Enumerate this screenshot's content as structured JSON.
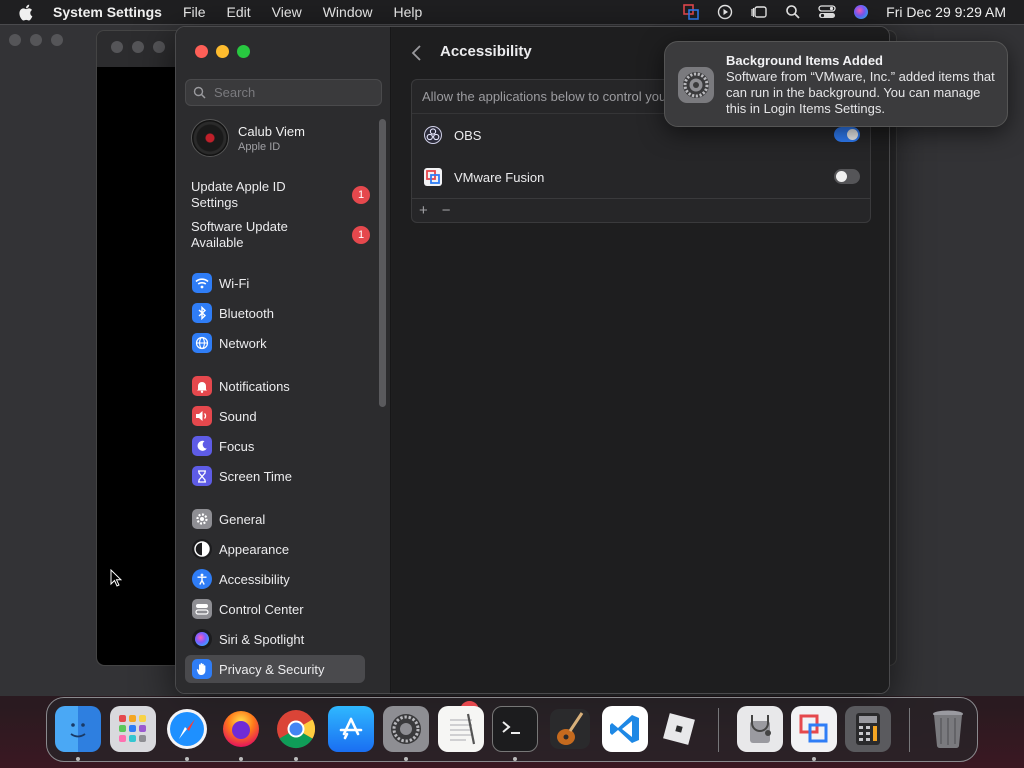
{
  "menubar": {
    "app_name": "System Settings",
    "menus": [
      "File",
      "Edit",
      "View",
      "Window",
      "Help"
    ],
    "clock": "Fri Dec 29  9:29 AM"
  },
  "sidebar": {
    "search_placeholder": "Search",
    "profile": {
      "name": "Calub Viem",
      "subtitle": "Apple ID"
    },
    "alerts": [
      {
        "label": "Update Apple ID Settings",
        "count": "1"
      },
      {
        "label": "Software Update Available",
        "count": "1"
      }
    ],
    "items": [
      {
        "label": "Wi-Fi",
        "icon": "wifi-icon",
        "color": "#2f7df6"
      },
      {
        "label": "Bluetooth",
        "icon": "bluetooth-icon",
        "color": "#2f7df6"
      },
      {
        "label": "Network",
        "icon": "globe-icon",
        "color": "#2f7df6"
      },
      {
        "label": "Notifications",
        "icon": "bell-icon",
        "color": "#e5484d"
      },
      {
        "label": "Sound",
        "icon": "speaker-icon",
        "color": "#e5484d"
      },
      {
        "label": "Focus",
        "icon": "moon-icon",
        "color": "#5e5ce6"
      },
      {
        "label": "Screen Time",
        "icon": "hourglass-icon",
        "color": "#5e5ce6"
      },
      {
        "label": "General",
        "icon": "gear-icon",
        "color": "#8e8e93"
      },
      {
        "label": "Appearance",
        "icon": "appearance-icon",
        "color": "#1c1c1e"
      },
      {
        "label": "Accessibility",
        "icon": "accessibility-icon",
        "color": "#2f7df6"
      },
      {
        "label": "Control Center",
        "icon": "control-center-icon",
        "color": "#8e8e93"
      },
      {
        "label": "Siri & Spotlight",
        "icon": "siri-icon",
        "color": "#1c1c1e"
      },
      {
        "label": "Privacy & Security",
        "icon": "hand-icon",
        "color": "#2f7df6"
      }
    ]
  },
  "content": {
    "title": "Accessibility",
    "panel_header": "Allow the applications below to control your computer.",
    "apps": [
      {
        "name": "OBS",
        "enabled": true
      },
      {
        "name": "VMware Fusion",
        "enabled": false
      }
    ],
    "add_label": "+",
    "remove_label": "−"
  },
  "notification": {
    "title": "Background Items Added",
    "body": "Software from “VMware, Inc.” added items that can run in the background. You can manage this in Login Items Settings."
  },
  "dock": {
    "items": [
      "finder-icon",
      "launchpad-icon",
      "safari-icon",
      "firefox-icon",
      "chrome-icon",
      "app-store-icon",
      "system-settings-icon",
      "textedit-icon",
      "terminal-icon",
      "garageband-icon",
      "vscode-icon",
      "roblox-icon",
      "disk-utility-icon",
      "vmware-fusion-icon",
      "calculator-icon",
      "trash-icon"
    ],
    "settings_badge": "2"
  }
}
